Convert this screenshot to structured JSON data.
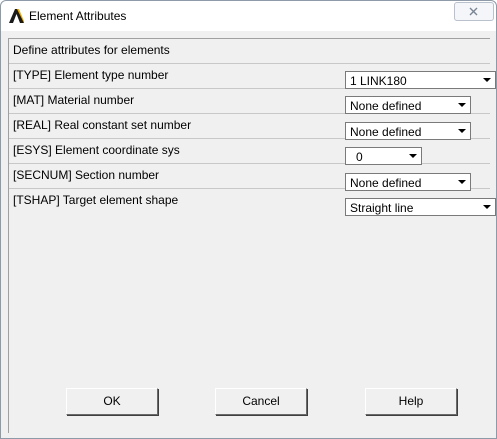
{
  "window": {
    "title": "Element Attributes",
    "close_icon": "close-x-icon"
  },
  "header": {
    "label": "Define attributes for elements"
  },
  "rows": [
    {
      "label": "[TYPE]  Element type number",
      "value": "1   LINK180"
    },
    {
      "label": "[MAT]   Material number",
      "value": "None defined"
    },
    {
      "label": "[REAL]  Real constant set number",
      "value": "None defined"
    },
    {
      "label": "[ESYS]  Element coordinate sys",
      "value": "0"
    },
    {
      "label": "[SECNUM]  Section number",
      "value": "None defined"
    },
    {
      "label": "[TSHAP]  Target element shape",
      "value": "Straight line"
    }
  ],
  "buttons": {
    "ok": "OK",
    "cancel": "Cancel",
    "help": "Help"
  }
}
